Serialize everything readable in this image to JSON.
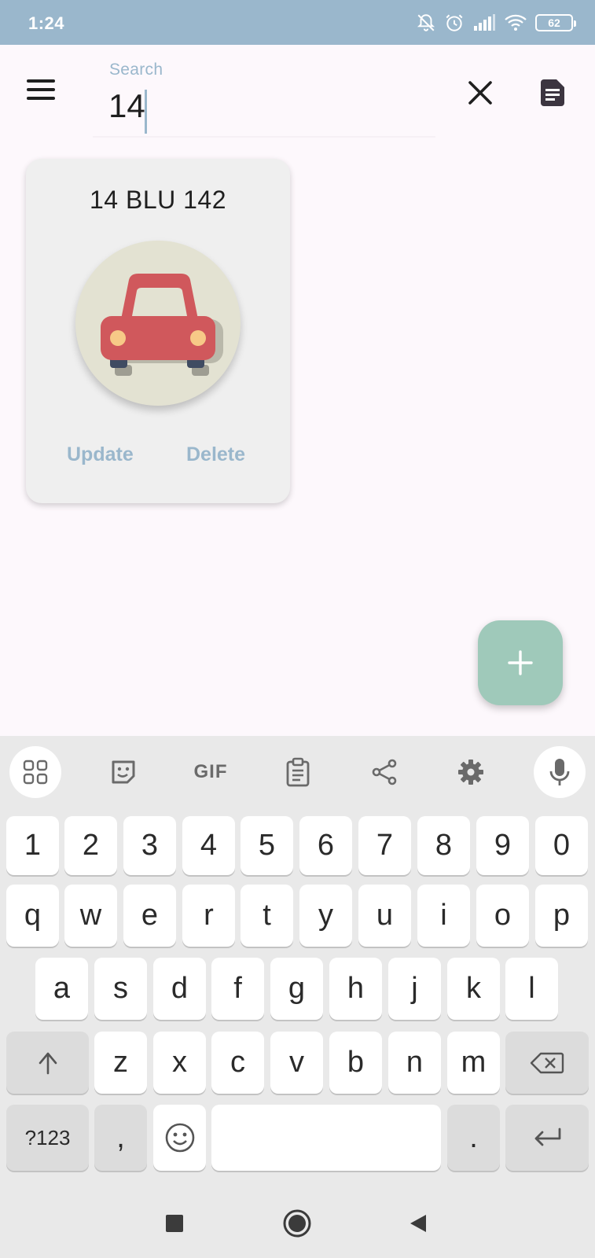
{
  "status_bar": {
    "time": "1:24",
    "battery": "62",
    "icons": [
      "notifications-off-icon",
      "alarm-icon",
      "signal-icon",
      "wifi-icon",
      "battery-icon"
    ]
  },
  "app_bar": {
    "search_label": "Search",
    "search_value": "14",
    "icons": [
      "menu-icon",
      "close-icon",
      "document-icon"
    ]
  },
  "card": {
    "title": "14 BLU 142",
    "update_label": "Update",
    "delete_label": "Delete",
    "image_icon": "car-icon"
  },
  "fab": {
    "icon": "plus-icon"
  },
  "keyboard": {
    "toolbar": {
      "gif_label": "GIF",
      "icons": [
        "apps-icon",
        "sticker-icon",
        "gif-icon",
        "clipboard-icon",
        "share-icon",
        "settings-icon",
        "mic-icon"
      ]
    },
    "row_numbers": [
      "1",
      "2",
      "3",
      "4",
      "5",
      "6",
      "7",
      "8",
      "9",
      "0"
    ],
    "row_top": [
      "q",
      "w",
      "e",
      "r",
      "t",
      "y",
      "u",
      "i",
      "o",
      "p"
    ],
    "row_mid": [
      "a",
      "s",
      "d",
      "f",
      "g",
      "h",
      "j",
      "k",
      "l"
    ],
    "row_bottom": [
      "z",
      "x",
      "c",
      "v",
      "b",
      "n",
      "m"
    ],
    "symbols_label": "?123",
    "comma": ",",
    "period": "."
  },
  "colors": {
    "status_bar": "#9ab7cc",
    "accent": "#9ab7cc",
    "fab": "#9fc9ba",
    "car_body": "#d0585c",
    "car_circle": "#e3e2d2"
  }
}
